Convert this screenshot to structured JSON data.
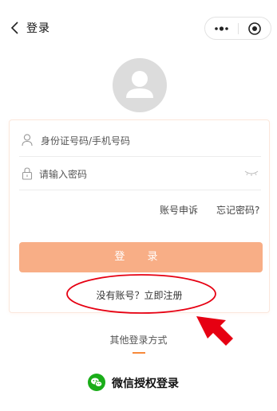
{
  "nav": {
    "title": "登录",
    "back_icon": "chevron-left-icon",
    "more_icon": "more-dots-icon",
    "close_icon": "target-circle-icon"
  },
  "avatar": {
    "icon": "user-avatar-icon"
  },
  "form": {
    "account_placeholder": "身份证号码/手机号码",
    "password_placeholder": "请输入密码",
    "account_icon": "user-icon",
    "password_icon": "lock-icon",
    "eye_icon": "eye-closed-icon"
  },
  "links": {
    "appeal": "账号申诉",
    "forgot": "忘记密码?"
  },
  "login_button": "登 录",
  "register_link": "没有账号？立即注册",
  "other_login": {
    "title": "其他登录方式",
    "wechat_label": "微信授权登录",
    "wechat_icon": "wechat-icon"
  },
  "colors": {
    "accent": "#f7893a",
    "button": "#f8ae86",
    "annotation": "#e60012",
    "wechat": "#1aad19"
  }
}
